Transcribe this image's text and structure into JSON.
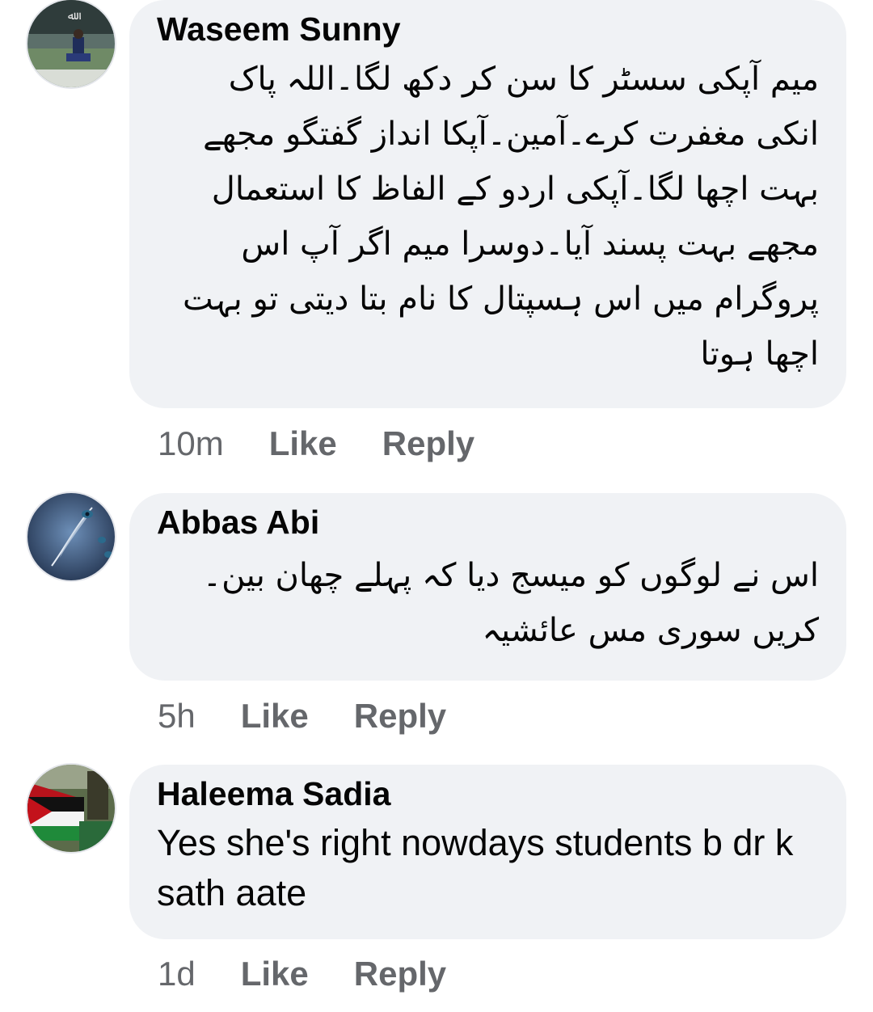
{
  "comments": [
    {
      "author": "Waseem Sunny",
      "text": "میم آپکی سسٹر کا سن کر دکھ لگا۔اللہ پاک انکی مغفرت کرے۔آمین۔آپکا انداز گفتگو مجھے بہت اچھا لگا۔آپکی اردو کے الفاظ کا استعمال مجھے بہت پسند آیا۔دوسرا میم اگر آپ اس پروگرام میں اس ہسپتال کا نام بتا دیتی تو بہت اچھا ہوتا",
      "time": "10m",
      "like_label": "Like",
      "reply_label": "Reply"
    },
    {
      "author": "Abbas Abi",
      "text": "اس نے لوگوں کو میسج دیا کہ پہلے چھان بین۔ کریں سوری مس عائشیہ",
      "time": "5h",
      "like_label": "Like",
      "reply_label": "Reply"
    },
    {
      "author": "Haleema Sadia",
      "text": "Yes she's right nowdays students b dr k sath aate",
      "time": "1d",
      "like_label": "Like",
      "reply_label": "Reply"
    }
  ],
  "colors": {
    "bubble": "#f0f2f5",
    "author": "#050505",
    "meta": "#65676b"
  }
}
